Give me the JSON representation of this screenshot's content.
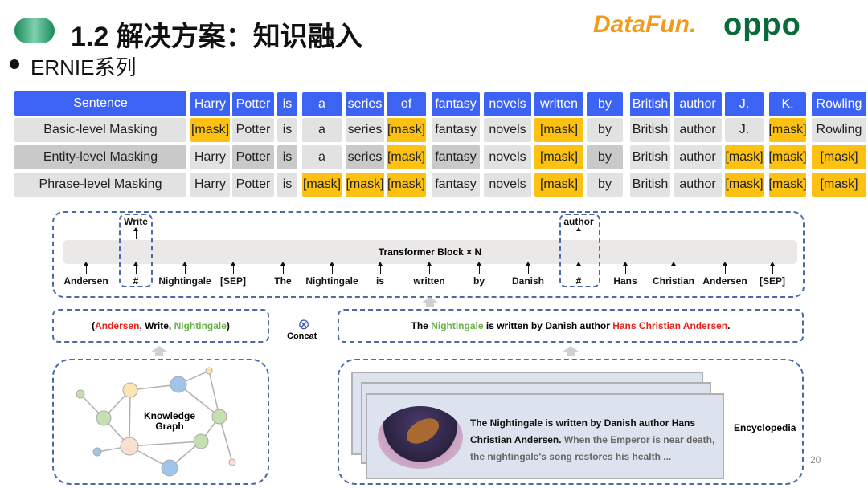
{
  "slide": {
    "title": "1.2 解决方案：知识融入",
    "subtitle": "ERNIE系列",
    "page_number": "20",
    "logos": [
      "DataFun.",
      "oppo"
    ]
  },
  "masking_table": {
    "columns": [
      "Harry",
      "Potter",
      "is",
      "a",
      "series",
      "of",
      "fantasy",
      "novels",
      "written",
      "by",
      "British",
      "author",
      "J.",
      "K.",
      "Rowling"
    ],
    "header_label": "Sentence",
    "rows": [
      {
        "label": "Basic-level Masking",
        "masked": [
          0,
          5,
          8,
          13
        ]
      },
      {
        "label": "Entity-level Masking",
        "masked": [
          5,
          8,
          12,
          13,
          14
        ]
      },
      {
        "label": "Phrase-level Masking",
        "masked": [
          3,
          4,
          5,
          8,
          12,
          13,
          14
        ]
      }
    ],
    "mask_token": "[mask]",
    "colors": {
      "header": "#3d63f5",
      "mask": "#fdc113",
      "plain": "#e2e2e2"
    }
  },
  "transformer": {
    "block_label": "Transformer Block × N",
    "tokens": [
      "Andersen",
      "#",
      "Nightingale",
      "[SEP]",
      "The",
      "Nightingale",
      "is",
      "written",
      "by",
      "Danish",
      "#",
      "Hans",
      "Christian",
      "Andersen",
      "[SEP]"
    ],
    "outputs": [
      {
        "token_index": 1,
        "label": "Write"
      },
      {
        "token_index": 10,
        "label": "author"
      }
    ]
  },
  "triple": {
    "open": "(",
    "head": "Andersen",
    "sep1": ", ",
    "relation": "Write",
    "sep2": ", ",
    "tail": "Nightingale",
    "close": ")"
  },
  "concat": {
    "symbol": "⊗",
    "label": "Concat"
  },
  "sentence": {
    "p1": "The ",
    "entity1": "Nightingale",
    "p2": " is written by Danish author ",
    "entity2": "Hans Christian Andersen",
    "p3": "."
  },
  "knowledge_graph": {
    "label_line1": "Knowledge",
    "label_line2": "Graph"
  },
  "encyclopedia": {
    "label": "Encyclopedia",
    "bold_text": "The Nightingale is written by Danish author Hans Christian Andersen.",
    "gray_text": " When the Emperor is near death, the nightingale's song restores his health ..."
  }
}
